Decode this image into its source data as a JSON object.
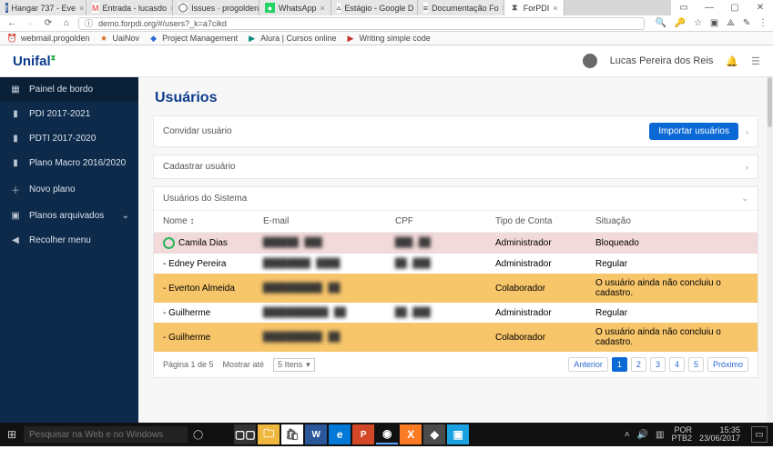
{
  "browser": {
    "tabs": [
      {
        "fav": "f",
        "favcls": "w-fb",
        "label": "Hangar 737 - Eve"
      },
      {
        "fav": "M",
        "favcls": "w-gm",
        "label": "Entrada - lucasdo"
      },
      {
        "fav": "◯",
        "favcls": "w-gh",
        "label": "Issues · progolden"
      },
      {
        "fav": "●",
        "favcls": "w-wa",
        "label": "WhatsApp"
      },
      {
        "fav": "▵",
        "favcls": "w-gd",
        "label": "Estágio - Google D"
      },
      {
        "fav": "≡",
        "favcls": "w-gd",
        "label": "Documentação Fo"
      },
      {
        "fav": "⧗",
        "favcls": "w-gh",
        "label": "ForPDI",
        "active": true
      }
    ],
    "url": "demo.forpdi.org/#/users?_k=a7cikd"
  },
  "bookmarks": [
    {
      "icon": "⏰",
      "label": "webmail.progolden",
      "cls": "orange"
    },
    {
      "icon": "★",
      "label": "UaiNov",
      "cls": "orange"
    },
    {
      "icon": "◆",
      "label": "Project Management",
      "cls": "blue"
    },
    {
      "icon": "▶",
      "label": "Alura | Cursos online",
      "cls": "teal"
    },
    {
      "icon": "▶",
      "label": "Writing simple code",
      "cls": "red"
    }
  ],
  "header": {
    "logo_main": "Unifal",
    "logo_sup": "⧗",
    "user_name": "Lucas Pereira dos Reis"
  },
  "sidebar": {
    "items": [
      {
        "icon": "▦",
        "label": "Painel de bordo",
        "active": true
      },
      {
        "icon": "▮",
        "label": "PDI 2017-2021"
      },
      {
        "icon": "▮",
        "label": "PDTI 2017-2020"
      },
      {
        "icon": "▮",
        "label": "Plano Macro 2016/2020"
      },
      {
        "icon": "＋",
        "label": "Novo plano"
      },
      {
        "icon": "▣",
        "label": "Planos arquivados",
        "chev": "⌄"
      },
      {
        "icon": "◀",
        "label": "Recolher menu"
      }
    ]
  },
  "page": {
    "title": "Usuários",
    "panel_invite": {
      "title": "Convidar usuário",
      "button": "Importar usuários",
      "chev": "›"
    },
    "panel_register": {
      "title": "Cadastrar usuário",
      "chev": "›"
    },
    "panel_list": {
      "title": "Usuários do Sistema",
      "chev": "⌄",
      "columns": {
        "name": "Nome ↕",
        "email": "E-mail",
        "cpf": "CPF",
        "tipo": "Tipo de Conta",
        "sit": "Situação"
      },
      "rows": [
        {
          "state": "blocked",
          "name": "Camila Dias",
          "avatar": true,
          "email": "██████ ███",
          "cpf": "███.██",
          "tipo": "Administrador",
          "sit": "Bloqueado"
        },
        {
          "state": "",
          "name": "- Edney Pereira",
          "email": "████████ ████",
          "cpf": "██.███",
          "tipo": "Administrador",
          "sit": "Regular"
        },
        {
          "state": "pending",
          "name": "- Everton Almeida",
          "email": "██████████ ██",
          "cpf": "",
          "tipo": "Colaborador",
          "sit": "O usuário ainda não concluiu o cadastro."
        },
        {
          "state": "",
          "name": "- Guilherme",
          "email": "███████████ ██",
          "cpf": "██.███",
          "tipo": "Administrador",
          "sit": "Regular"
        },
        {
          "state": "pending",
          "name": "- Guilherme",
          "email": "██████████ ██",
          "cpf": "",
          "tipo": "Colaborador",
          "sit": "O usuário ainda não concluiu o cadastro."
        }
      ],
      "footer": {
        "page_info": "Página 1 de 5",
        "show_label": "Mostrar até",
        "show_value": "5 Itens",
        "prev": "Anterior",
        "next": "Próximo",
        "pages": [
          "1",
          "2",
          "3",
          "4",
          "5"
        ]
      }
    }
  },
  "taskbar": {
    "search_placeholder": "Pesquisar na Web e no Windows",
    "apps": [
      {
        "cls": "w-task",
        "glyph": "▢▢"
      },
      {
        "cls": "w-file",
        "glyph": "🗀"
      },
      {
        "cls": "w-store",
        "glyph": "🛍"
      },
      {
        "cls": "w-word",
        "glyph": "W"
      },
      {
        "cls": "w-edge",
        "glyph": "e"
      },
      {
        "cls": "w-ppt",
        "glyph": "P"
      },
      {
        "cls": "w-chrome",
        "glyph": "◉",
        "active": true
      },
      {
        "cls": "w-xampp",
        "glyph": "X"
      },
      {
        "cls": "w-sub",
        "glyph": "◆"
      },
      {
        "cls": "w-img",
        "glyph": "▣"
      }
    ],
    "tray": {
      "lang": "POR",
      "kb": "PTB2",
      "time": "15:35",
      "date": "23/06/2017"
    }
  }
}
